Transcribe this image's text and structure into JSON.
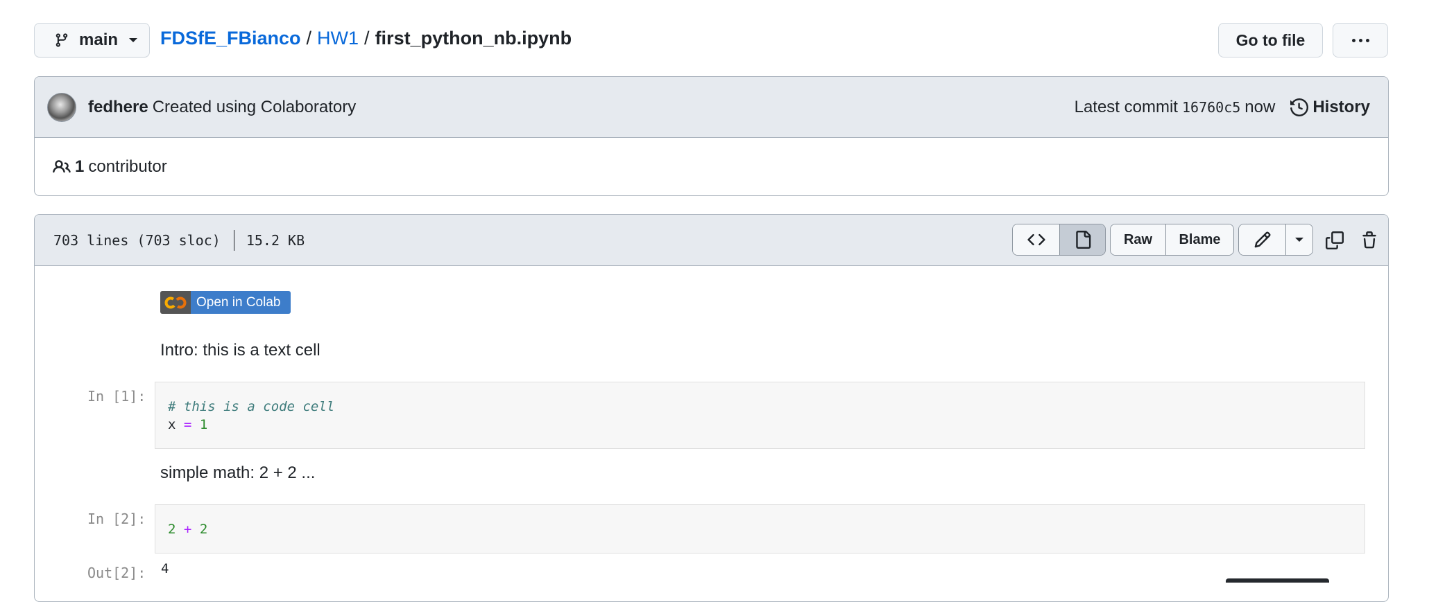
{
  "toolbar": {
    "branch": "main",
    "breadcrumb": {
      "repo": "FDSfE_FBianco",
      "sep1": "/",
      "folder": "HW1",
      "sep2": "/",
      "file": "first_python_nb.ipynb"
    },
    "go_to_file": "Go to file"
  },
  "commit": {
    "author": "fedhere",
    "message": "Created using Colaboratory",
    "latest_label": "Latest commit",
    "sha": "16760c5",
    "time": "now",
    "history": "History",
    "contributors_count": "1",
    "contributors_label": "contributor"
  },
  "file": {
    "lines": "703 lines (703 sloc)",
    "size": "15.2 KB",
    "raw": "Raw",
    "blame": "Blame"
  },
  "notebook": {
    "badge": "Open in Colab",
    "md1": "Intro: this is a text cell",
    "cell1": {
      "prompt": "In [1]:",
      "comment": "# this is a code cell",
      "var": "x",
      "op": "=",
      "val": "1"
    },
    "md2": "simple math: 2 + 2 ...",
    "cell2": {
      "prompt": "In [2]:",
      "a": "2",
      "op": "+",
      "b": "2"
    },
    "out2": {
      "prompt": "Out[2]:",
      "value": "4"
    }
  }
}
